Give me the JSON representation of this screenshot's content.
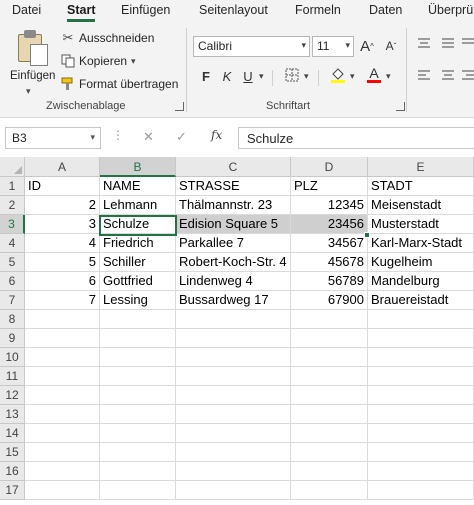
{
  "ribbon_tabs": [
    {
      "label": "Datei",
      "active": false
    },
    {
      "label": "Start",
      "active": true
    },
    {
      "label": "Einfügen",
      "active": false
    },
    {
      "label": "Seitenlayout",
      "active": false
    },
    {
      "label": "Formeln",
      "active": false
    },
    {
      "label": "Daten",
      "active": false
    },
    {
      "label": "Überprü",
      "active": false
    }
  ],
  "clipboard": {
    "paste_label": "Einfügen",
    "cut_label": "Ausschneiden",
    "copy_label": "Kopieren",
    "format_painter_label": "Format übertragen",
    "group_label": "Zwischenablage"
  },
  "font": {
    "font_name": "Calibri",
    "font_size": "11",
    "bold": "F",
    "italic": "K",
    "underline": "U",
    "grow": "A",
    "shrink": "A",
    "color_letter": "A",
    "group_label": "Schriftart",
    "accent_color": "#217346",
    "highlight_color": "#ffff00",
    "font_color": "#ff0000"
  },
  "formula_bar": {
    "name_box": "B3",
    "fx": "fx",
    "formula_value": "Schulze"
  },
  "sheet": {
    "columns": [
      "A",
      "B",
      "C",
      "D",
      "E"
    ],
    "selected_column": "B",
    "selected_row": 3,
    "active_cell": "B3",
    "highlight_range": "C3:D3",
    "rows": [
      {
        "n": "1",
        "cells": [
          "ID",
          "NAME",
          "STRASSE",
          "PLZ",
          "STADT"
        ]
      },
      {
        "n": "2",
        "cells": [
          "2",
          "Lehmann",
          "Thälmannstr. 23",
          "12345",
          "Meisenstadt"
        ]
      },
      {
        "n": "3",
        "cells": [
          "3",
          "Schulze",
          "Edision Square 5",
          "23456",
          "Musterstadt"
        ]
      },
      {
        "n": "4",
        "cells": [
          "4",
          "Friedrich",
          "Parkallee 7",
          "34567",
          "Karl-Marx-Stadt"
        ]
      },
      {
        "n": "5",
        "cells": [
          "5",
          "Schiller",
          "Robert-Koch-Str. 4",
          "45678",
          "Kugelheim"
        ]
      },
      {
        "n": "6",
        "cells": [
          "6",
          "Gottfried",
          "Lindenweg 4",
          "56789",
          "Mandelburg"
        ]
      },
      {
        "n": "7",
        "cells": [
          "7",
          "Lessing",
          "Bussardweg 17",
          "67900",
          "Brauereistadt"
        ]
      },
      {
        "n": "8",
        "cells": [
          "",
          "",
          "",
          "",
          ""
        ]
      },
      {
        "n": "9",
        "cells": [
          "",
          "",
          "",
          "",
          ""
        ]
      },
      {
        "n": "10",
        "cells": [
          "",
          "",
          "",
          "",
          ""
        ]
      },
      {
        "n": "11",
        "cells": [
          "",
          "",
          "",
          "",
          ""
        ]
      },
      {
        "n": "12",
        "cells": [
          "",
          "",
          "",
          "",
          ""
        ]
      },
      {
        "n": "13",
        "cells": [
          "",
          "",
          "",
          "",
          ""
        ]
      },
      {
        "n": "14",
        "cells": [
          "",
          "",
          "",
          "",
          ""
        ]
      },
      {
        "n": "15",
        "cells": [
          "",
          "",
          "",
          "",
          ""
        ]
      },
      {
        "n": "16",
        "cells": [
          "",
          "",
          "",
          "",
          ""
        ]
      },
      {
        "n": "17",
        "cells": [
          "",
          "",
          "",
          "",
          ""
        ]
      }
    ]
  }
}
